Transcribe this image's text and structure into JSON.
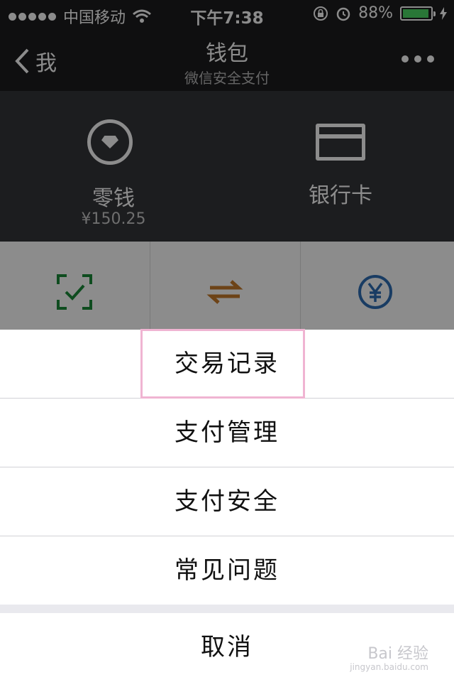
{
  "status_bar": {
    "carrier": "中国移动",
    "time": "下午7:38",
    "battery": "88%",
    "battery_level": 0.88
  },
  "nav": {
    "back_label": "我",
    "title": "钱包",
    "subtitle": "微信安全支付"
  },
  "wallet": {
    "change_label": "零钱",
    "change_amount": "¥150.25",
    "bank_card_label": "银行卡"
  },
  "action_sheet": {
    "items": [
      "交易记录",
      "支付管理",
      "支付安全",
      "常见问题"
    ],
    "cancel": "取消"
  },
  "watermark": {
    "text": "Bai 经验",
    "sub": "jingyan.baidu.com"
  },
  "colors": {
    "grid_icon_green": "#1a8a3a",
    "grid_icon_orange": "#c77a2a",
    "grid_icon_blue": "#2f6db5",
    "highlight": "#f0b4d2"
  }
}
